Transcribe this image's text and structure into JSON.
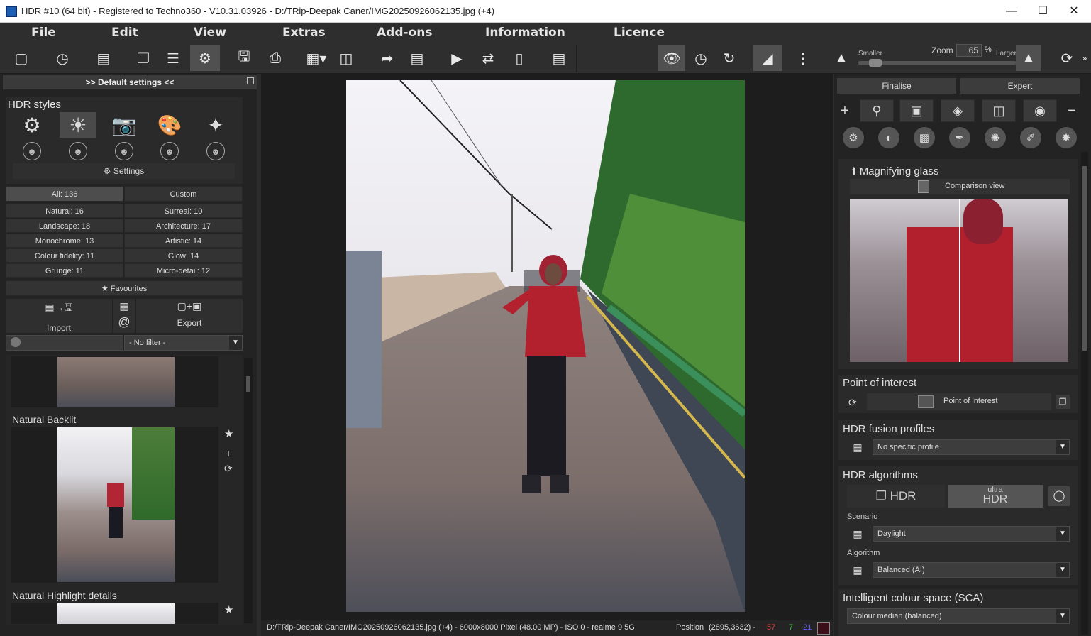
{
  "window": {
    "title": "HDR #10 (64 bit) - Registered to Techno360 - V10.31.03926 - D:/TRip-Deepak Caner/IMG20250926062135.jpg (+4)"
  },
  "menu": [
    "File",
    "Edit",
    "View",
    "Extras",
    "Add-ons",
    "Information",
    "Licence"
  ],
  "toolbar": {
    "zoom_label": "Zoom",
    "zoom_value": "65",
    "zoom_unit": "%",
    "smaller": "Smaller",
    "larger": "Larger",
    "zoom_level": 0.1
  },
  "left": {
    "header": ">> Default settings <<",
    "hdr_styles": "HDR styles",
    "settings": "Settings",
    "tabs": [
      "All: 136",
      "Custom"
    ],
    "categories": [
      [
        "Natural: 16",
        "Surreal: 10"
      ],
      [
        "Landscape: 18",
        "Architecture: 17"
      ],
      [
        "Monochrome: 13",
        "Artistic: 14"
      ],
      [
        "Colour fidelity: 11",
        "Glow: 14"
      ],
      [
        "Grunge: 11",
        "Micro-detail: 12"
      ]
    ],
    "favourites": "Favourites",
    "import": "Import",
    "export": "Export",
    "at": "@",
    "filter": "- No filter -",
    "previews": [
      "Natural Backlit",
      "Natural Highlight details"
    ]
  },
  "status": {
    "path": "D:/TRip-Deepak Caner/IMG20250926062135.jpg (+4) - 6000x8000 Pixel (48.00 MP)  - ISO 0 - realme 9 5G",
    "position_label": "Position",
    "position": "(2895,3632) -",
    "r": "57",
    "g": "7",
    "b": "21"
  },
  "right": {
    "tabs": [
      "Finalise",
      "Expert"
    ],
    "magnify": {
      "title": "Magnifying glass",
      "comparison": "Comparison view"
    },
    "poi": {
      "title": "Point of interest",
      "button": "Point of interest"
    },
    "fusion": {
      "title": "HDR fusion profiles",
      "value": "No specific profile"
    },
    "algorithms": {
      "title": "HDR algorithms",
      "hdr": "HDR",
      "ultra_top": "ultra",
      "ultra_bottom": "HDR",
      "scenario_label": "Scenario",
      "scenario": "Daylight",
      "algorithm_label": "Algorithm",
      "algorithm": "Balanced (AI)"
    },
    "sca": {
      "title": "Intelligent colour space (SCA)",
      "value": "Colour median (balanced)"
    }
  },
  "colors": {
    "accent": "#1a5fb4",
    "status_r": "#e04040",
    "status_g": "#40c040",
    "status_b": "#6060ff",
    "swatch": "#3a0f1a"
  }
}
